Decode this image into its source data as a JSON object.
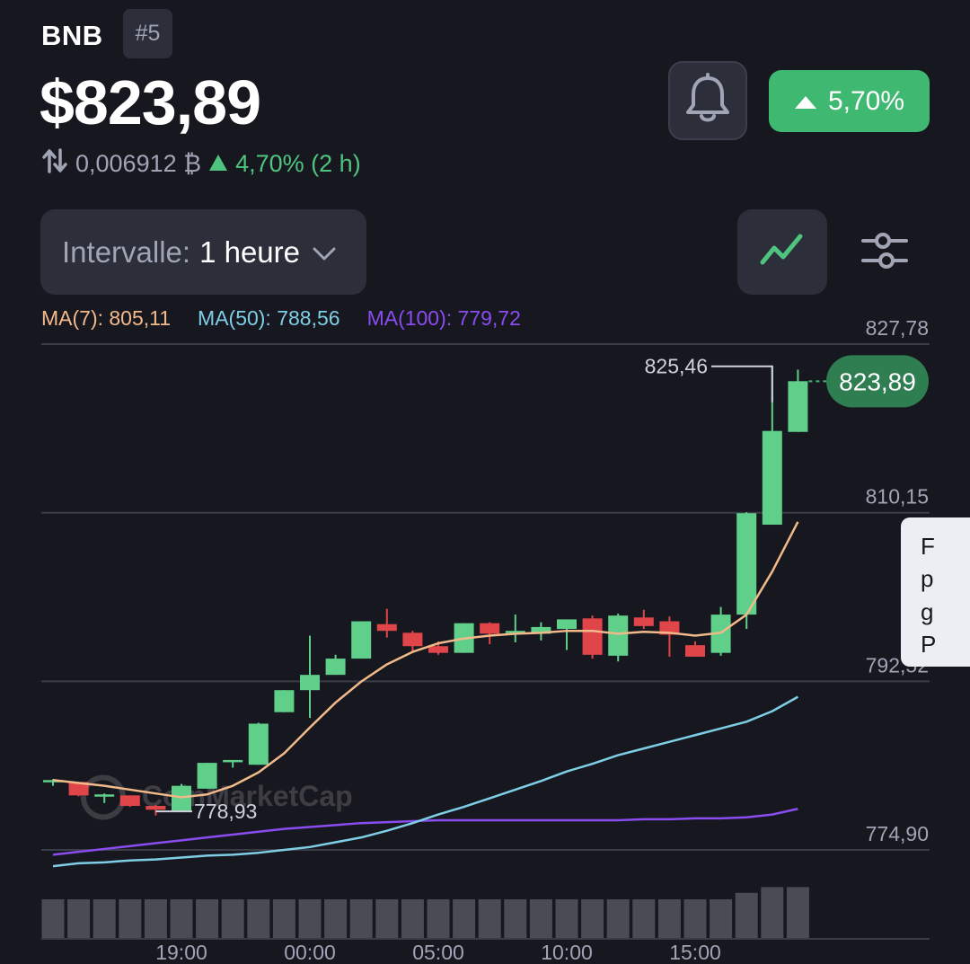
{
  "header": {
    "symbol": "BNB",
    "rank": "#5",
    "price": "$823,89",
    "btc_value": "0,006912 ₿",
    "btc_change": "4,70% (2 h)",
    "change_badge": "5,70%"
  },
  "controls": {
    "interval_label": "Intervalle:",
    "interval_value": "1 heure"
  },
  "moving_averages": {
    "ma7": "MA(7): 805,11",
    "ma50": "MA(50): 788,56",
    "ma100": "MA(100): 779,72"
  },
  "colors": {
    "up": "#5fcf8a",
    "down": "#e0454a",
    "ma7": "#f2b98a",
    "ma50": "#7ecfe6",
    "ma100": "#8a4cf0",
    "badge": "#3fb871"
  },
  "tooltip_peek": [
    "F",
    "p",
    "g",
    "P"
  ],
  "chart_data": {
    "type": "candlestick",
    "y_ticks": [
      {
        "v": 827.78,
        "label": "827,78"
      },
      {
        "v": 810.15,
        "label": "810,15"
      },
      {
        "v": 792.52,
        "label": "792,52"
      },
      {
        "v": 774.9,
        "label": "774,90"
      }
    ],
    "x_ticks": [
      {
        "i": 5,
        "label": "19:00"
      },
      {
        "i": 10,
        "label": "00:00"
      },
      {
        "i": 15,
        "label": "05:00"
      },
      {
        "i": 20,
        "label": "10:00"
      },
      {
        "i": 25,
        "label": "15:00"
      }
    ],
    "current_price": {
      "v": 823.89,
      "label": "823,89"
    },
    "high_annotation": {
      "v": 825.46,
      "label": "825,46"
    },
    "low_annotation": {
      "v": 778.93,
      "label": "778,93"
    },
    "watermark": "CoinMarketCap",
    "candles": [
      {
        "o": 782.0,
        "h": 782.3,
        "l": 781.6,
        "c": 782.2
      },
      {
        "o": 782.0,
        "h": 782.0,
        "l": 780.5,
        "c": 780.6
      },
      {
        "o": 780.6,
        "h": 780.8,
        "l": 779.8,
        "c": 780.7
      },
      {
        "o": 780.6,
        "h": 780.6,
        "l": 779.4,
        "c": 779.5
      },
      {
        "o": 779.5,
        "h": 779.6,
        "l": 778.5,
        "c": 779.1
      },
      {
        "o": 779.0,
        "h": 781.8,
        "l": 778.9,
        "c": 781.6
      },
      {
        "o": 781.3,
        "h": 784.0,
        "l": 781.3,
        "c": 784.0
      },
      {
        "o": 784.1,
        "h": 784.3,
        "l": 783.5,
        "c": 784.3
      },
      {
        "o": 783.8,
        "h": 788.2,
        "l": 783.8,
        "c": 788.1
      },
      {
        "o": 789.3,
        "h": 791.6,
        "l": 789.3,
        "c": 791.6
      },
      {
        "o": 791.6,
        "h": 797.3,
        "l": 788.7,
        "c": 793.2
      },
      {
        "o": 793.2,
        "h": 795.3,
        "l": 793.2,
        "c": 794.9
      },
      {
        "o": 794.9,
        "h": 798.8,
        "l": 794.9,
        "c": 798.8
      },
      {
        "o": 798.5,
        "h": 800.1,
        "l": 797.1,
        "c": 797.8
      },
      {
        "o": 797.6,
        "h": 797.8,
        "l": 795.5,
        "c": 796.2
      },
      {
        "o": 796.2,
        "h": 796.7,
        "l": 795.3,
        "c": 795.5
      },
      {
        "o": 795.5,
        "h": 798.6,
        "l": 795.5,
        "c": 798.6
      },
      {
        "o": 798.6,
        "h": 798.7,
        "l": 796.4,
        "c": 797.5
      },
      {
        "o": 797.6,
        "h": 799.5,
        "l": 796.6,
        "c": 797.8
      },
      {
        "o": 797.5,
        "h": 798.7,
        "l": 796.8,
        "c": 798.2
      },
      {
        "o": 798.0,
        "h": 799.0,
        "l": 795.8,
        "c": 799.0
      },
      {
        "o": 799.1,
        "h": 799.4,
        "l": 794.9,
        "c": 795.3
      },
      {
        "o": 795.2,
        "h": 799.6,
        "l": 794.6,
        "c": 799.4
      },
      {
        "o": 799.2,
        "h": 800.0,
        "l": 798.0,
        "c": 798.3
      },
      {
        "o": 798.8,
        "h": 799.3,
        "l": 795.1,
        "c": 797.4
      },
      {
        "o": 796.3,
        "h": 796.7,
        "l": 795.2,
        "c": 795.1
      },
      {
        "o": 795.5,
        "h": 800.3,
        "l": 795.2,
        "c": 799.5
      },
      {
        "o": 799.5,
        "h": 810.2,
        "l": 798.0,
        "c": 810.1
      },
      {
        "o": 808.9,
        "h": 825.5,
        "l": 808.9,
        "c": 818.7
      },
      {
        "o": 818.6,
        "h": 825.1,
        "l": 818.6,
        "c": 823.9
      }
    ],
    "ma7": [
      782.2,
      781.9,
      781.6,
      781.2,
      780.8,
      780.4,
      780.7,
      781.6,
      783.0,
      785.0,
      787.7,
      790.3,
      792.5,
      794.3,
      795.6,
      796.5,
      797.0,
      797.3,
      797.5,
      797.6,
      797.8,
      797.8,
      797.5,
      797.7,
      797.6,
      797.3,
      797.6,
      799.5,
      804.0,
      809.2
    ],
    "ma50": [
      773.2,
      773.5,
      773.6,
      773.8,
      773.9,
      774.1,
      774.3,
      774.4,
      774.6,
      774.9,
      775.2,
      775.7,
      776.2,
      776.9,
      777.7,
      778.6,
      779.4,
      780.3,
      781.2,
      782.1,
      783.1,
      783.9,
      784.8,
      785.5,
      786.2,
      786.9,
      787.6,
      788.3,
      789.4,
      790.9
    ],
    "ma100": [
      774.4,
      774.7,
      775.0,
      775.3,
      775.6,
      775.9,
      776.2,
      776.5,
      776.8,
      777.1,
      777.3,
      777.5,
      777.7,
      777.8,
      777.9,
      778.0,
      778.0,
      778.0,
      778.0,
      778.0,
      778.0,
      778.0,
      778.0,
      778.1,
      778.1,
      778.2,
      778.2,
      778.3,
      778.6,
      779.2
    ],
    "volume": [
      0.55,
      0.55,
      0.55,
      0.55,
      0.55,
      0.55,
      0.55,
      0.55,
      0.55,
      0.55,
      0.55,
      0.55,
      0.55,
      0.55,
      0.55,
      0.55,
      0.55,
      0.55,
      0.55,
      0.55,
      0.55,
      0.55,
      0.55,
      0.55,
      0.55,
      0.55,
      0.55,
      0.64,
      0.72,
      0.72
    ]
  }
}
